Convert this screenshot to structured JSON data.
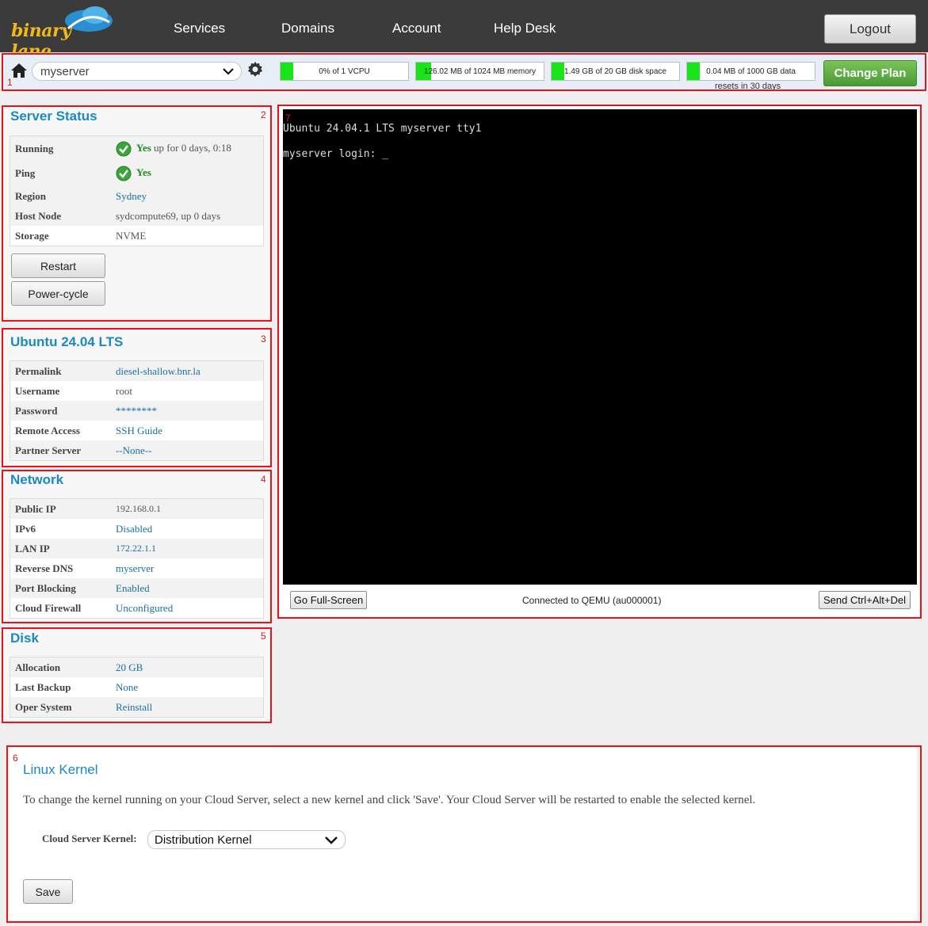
{
  "brand": {
    "logo_text": "binary lane"
  },
  "nav": {
    "items": [
      "Services",
      "Domains",
      "Account",
      "Help Desk"
    ],
    "logout": "Logout"
  },
  "server_bar": {
    "server": "myserver",
    "usage": [
      {
        "label": "0% of 1 VCPU",
        "fill": 0.0
      },
      {
        "label": "126.02 MB of 1024 MB memory",
        "fill": 0.12
      },
      {
        "label": "1.49 GB of 20 GB disk space",
        "fill": 0.07
      },
      {
        "label": "0.04 MB of 1000 GB data",
        "fill": 0.0
      }
    ],
    "resets": "resets in 30 days",
    "change_plan": "Change Plan"
  },
  "annotations": [
    "1",
    "2",
    "3",
    "4",
    "5",
    "6",
    "7"
  ],
  "server_status": {
    "title": "Server Status",
    "rows": [
      {
        "k": "Running",
        "v_bold": "Yes",
        "v": "up for 0 days, 0:18"
      },
      {
        "k": "Ping",
        "v_bold": "Yes"
      },
      {
        "k": "Region",
        "v": "Sydney"
      },
      {
        "k": "Host Node",
        "v": "sydcompute69, up 0 days"
      },
      {
        "k": "Storage",
        "v": "NVME"
      }
    ],
    "restart": "Restart",
    "power_cycle": "Power-cycle"
  },
  "os": {
    "title": "Ubuntu 24.04 LTS",
    "rows": [
      {
        "k": "Permalink",
        "v": "diesel-shallow.bnr.la"
      },
      {
        "k": "Username",
        "v": "root"
      },
      {
        "k": "Password",
        "v": "********"
      },
      {
        "k": "Remote Access",
        "v": "SSH Guide"
      },
      {
        "k": "Partner Server",
        "v": "--None--"
      }
    ]
  },
  "network": {
    "title": "Network",
    "rows": [
      {
        "k": "Public IP",
        "v": "192.168.0.1"
      },
      {
        "k": "IPv6",
        "v": "Disabled"
      },
      {
        "k": "LAN IP",
        "v": "172.22.1.1"
      },
      {
        "k": "Reverse DNS",
        "v": "myserver"
      },
      {
        "k": "Port Blocking",
        "v": "Enabled"
      },
      {
        "k": "Cloud Firewall",
        "v": "Unconfigured"
      }
    ]
  },
  "disk": {
    "title": "Disk",
    "rows": [
      {
        "k": "Allocation",
        "v": "20 GB"
      },
      {
        "k": "Last Backup",
        "v": "None"
      },
      {
        "k": "Oper System",
        "v": "Reinstall"
      }
    ]
  },
  "console": {
    "line1": "Ubuntu 24.04.1 LTS myserver tty1",
    "line2": "myserver login: _",
    "fullscreen": "Go Full-Screen",
    "status": "Connected to QEMU (au000001)",
    "ctrl_alt_del": "Send Ctrl+Alt+Del"
  },
  "kernel": {
    "title": "Linux Kernel",
    "description": "To change the kernel running on your Cloud Server, select a new kernel and click 'Save'. Your Cloud Server will be restarted to enable the selected kernel.",
    "label": "Cloud Server Kernel:",
    "selected": "Distribution Kernel",
    "save": "Save"
  },
  "colors": {
    "accent": "#1a89c4",
    "annotation": "#e0151d",
    "green": "#19e419",
    "topbar": "#3b3b3b"
  }
}
